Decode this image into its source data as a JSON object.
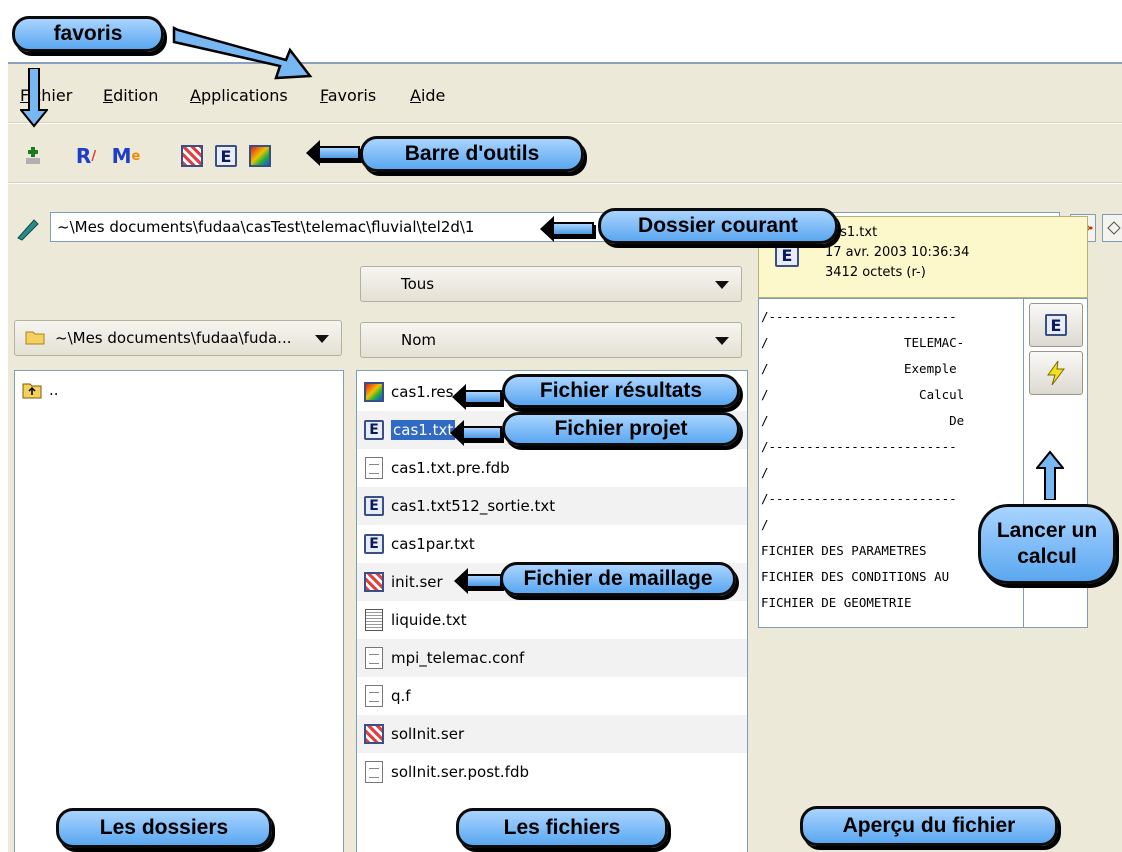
{
  "menu": {
    "items": [
      "Fichier",
      "Edition",
      "Applications",
      "Favoris",
      "Aide"
    ]
  },
  "toolbar": {
    "buttons": [
      "new-icon",
      "r-icon",
      "m-icon",
      "grid-icon",
      "e-icon",
      "results-icon"
    ],
    "r_label": "R",
    "m_label": "M",
    "e_label": "E"
  },
  "path": {
    "value": "~\\Mes documents\\fudaa\\casTest\\telemac\\fluvial\\tel2d\\1"
  },
  "folders": {
    "combo_value": "~\\Mes documents\\fudaa\\fuda...",
    "items": [
      ".."
    ]
  },
  "files": {
    "filter": "Tous",
    "sort": "Nom",
    "items": [
      {
        "name": "cas1.res",
        "icon": "results-icon"
      },
      {
        "name": "cas1.txt",
        "icon": "e-icon",
        "selected": true
      },
      {
        "name": "cas1.txt.pre.fdb",
        "icon": "doc-icon"
      },
      {
        "name": "cas1.txt512_sortie.txt",
        "icon": "e-icon"
      },
      {
        "name": "cas1par.txt",
        "icon": "e-icon"
      },
      {
        "name": "init.ser",
        "icon": "mesh-icon"
      },
      {
        "name": "liquide.txt",
        "icon": "data-icon"
      },
      {
        "name": "mpi_telemac.conf",
        "icon": "doc-icon"
      },
      {
        "name": "q.f",
        "icon": "doc-icon"
      },
      {
        "name": "solInit.ser",
        "icon": "mesh-icon"
      },
      {
        "name": "solInit.ser.post.fdb",
        "icon": "doc-icon"
      }
    ]
  },
  "preview": {
    "filename": "cas1.txt",
    "date": "17 avr. 2003 10:36:34",
    "size": "3412 octets (r-)",
    "lines": [
      "/-------------------------",
      "/                  TELEMAC-",
      "/                  Exemple",
      "/                    Calcul",
      "/                        De",
      "/-------------------------",
      "/",
      "/-------------------------",
      "/",
      "FICHIER DES PARAMETRES",
      "FICHIER DES CONDITIONS AU",
      "FICHIER DE GEOMETRIE"
    ]
  },
  "annotations": {
    "favoris": "favoris",
    "toolbar": "Barre d'outils",
    "current_folder": "Dossier courant",
    "results_file": "Fichier résultats",
    "project_file": "Fichier projet",
    "mesh_file": "Fichier de maillage",
    "run_calc": "Lancer un calcul",
    "folders": "Les dossiers",
    "files": "Les fichiers",
    "preview": "Aperçu du fichier"
  },
  "colors": {
    "selection": "#316ac5",
    "callout": "#6cb2f5",
    "window_bg": "#ece9d8"
  }
}
